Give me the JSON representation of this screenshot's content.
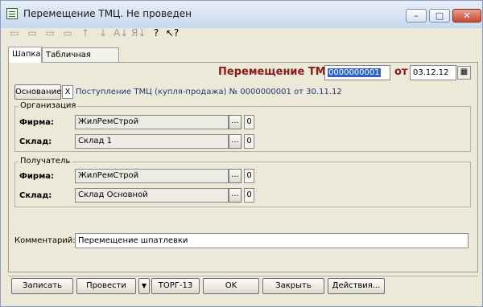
{
  "window": {
    "title": "Перемещение ТМЦ. Не проведен",
    "minimize_glyph": "–",
    "maximize_glyph": "□",
    "close_glyph": "✕"
  },
  "toolbar": {
    "icons": [
      "new-row-icon",
      "add-row-icon",
      "delete-row-icon",
      "edit-row-icon",
      "move-up-icon",
      "move-down-icon",
      "sort-ascending-icon",
      "sort-descending-icon",
      "help-icon",
      "context-help-icon"
    ],
    "glyphs": [
      "▭",
      "▭",
      "▭",
      "▭",
      "↑",
      "↓",
      "A↓",
      "Я↓",
      "?",
      "↖?"
    ]
  },
  "tabs": [
    "Шапка",
    "Табличная часть"
  ],
  "header": {
    "doc_label": "Перемещение ТМЦ №",
    "doc_number": "0000000001",
    "date_label": "от",
    "date_value": "03.12.12",
    "calendar_glyph": "▦"
  },
  "basis": {
    "button_label": "Основание",
    "clear_glyph": "X",
    "link_text": "Поступление ТМЦ (купля-продажа) № 0000000001 от 30.11.12"
  },
  "organization": {
    "title": "Организация",
    "firm_label": "Фирма:",
    "firm_value": "ЖилРемСтрой",
    "warehouse_label": "Склад:",
    "warehouse_value": "Склад 1"
  },
  "recipient": {
    "title": "Получатель",
    "firm_label": "Фирма:",
    "firm_value": "ЖилРемСтрой",
    "warehouse_label": "Склад:",
    "warehouse_value": "Склад Основной"
  },
  "common": {
    "dots": "...",
    "zero": "0"
  },
  "comment": {
    "label": "Комментарий:",
    "value": "Перемещение шпатлевки"
  },
  "buttons": {
    "save": "Записать",
    "post": "Провести",
    "arrow": "▼",
    "torg": "ТОРГ-13",
    "ok": "OK",
    "close": "Закрыть",
    "actions": "Действия..."
  }
}
